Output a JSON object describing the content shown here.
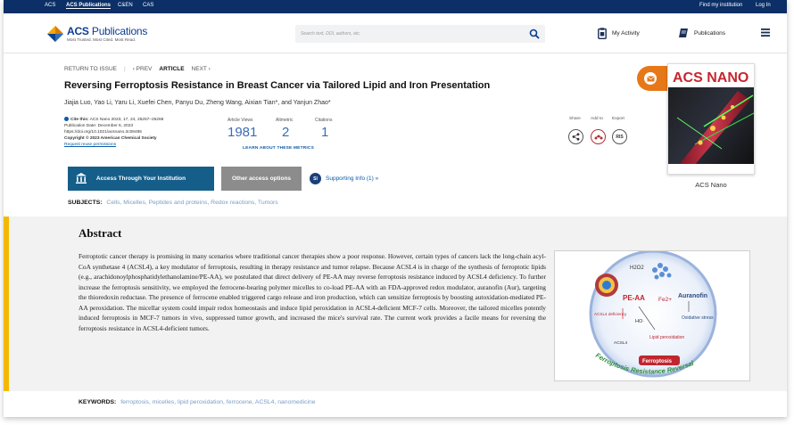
{
  "topbar": {
    "links": [
      "ACS",
      "ACS Publications",
      "C&EN",
      "CAS"
    ],
    "find_institution": "Find my institution",
    "login": "Log In"
  },
  "header": {
    "logo_title_bold": "ACS",
    "logo_title_rest": "Publications",
    "logo_tagline": "Most Trusted. Most Cited. Most Read.",
    "search_placeholder": "Search text, DOI, authors, etc.",
    "my_activity": "My Activity",
    "publications": "Publications"
  },
  "breadcrumb": {
    "return": "RETURN TO ISSUE",
    "prev": "‹ PREV",
    "current": "ARTICLE",
    "next": "NEXT ›"
  },
  "article": {
    "title": "Reversing Ferroptosis Resistance in Breast Cancer via Tailored Lipid and Iron Presentation",
    "authors": "Jiajia Luo, Yao Li, Yaru Li, Xuefei Chen, Panyu Du, Zheng Wang, Aixian Tian*, and Yanjun Zhao*",
    "cite_label": "Cite this:",
    "cite_text": "ACS Nano 2023, 17, 24, 25257–25268",
    "pub_date": "Publication Date: December 6, 2023",
    "doi": "https://doi.org/10.1021/acsnano.3c08485",
    "copyright": "Copyright © 2023 American Chemical Society",
    "reuse": "Request reuse permissions"
  },
  "metrics": {
    "views_label": "Article Views",
    "views": "1981",
    "altmetric_label": "Altmetric",
    "altmetric": "2",
    "citations_label": "Citations",
    "citations": "1",
    "learn_more": "LEARN ABOUT THESE METRICS"
  },
  "share": {
    "share_label": "Share",
    "add_label": "Add to",
    "export_label": "Export",
    "ris": "RIS"
  },
  "journal": {
    "cover_logo": "ACS NANO",
    "name": "ACS Nano"
  },
  "access": {
    "institution_button": "Access Through Your Institution",
    "other_button": "Other access options",
    "si_badge": "SI",
    "supporting": "Supporting Info (1) »"
  },
  "subjects": {
    "label": "SUBJECTS:",
    "items": "Cells, Micelles, Peptides and proteins, Redox reactions, Tumors"
  },
  "abstract": {
    "heading": "Abstract",
    "text": "Ferroptotic cancer therapy is promising in many scenarios where traditional cancer therapies show a poor response. However, certain types of cancers lack the long-chain acyl-CoA synthetase 4 (ACSL4), a key modulator of ferroptosis, resulting in therapy resistance and tumor relapse. Because ACSL4 is in charge of the synthesis of ferroptotic lipids (e.g., arachidonoylphosphatidylethanolamine/PE-AA), we postulated that direct delivery of PE-AA may reverse ferroptosis resistance induced by ACSL4 deficiency. To further increase the ferroptosis sensitivity, we employed the ferrocene-bearing polymer micelles to co-load PE-AA with an FDA-approved redox modulator, auranofin (Aur), targeting the thioredoxin reductase. The presence of ferrocene enabled triggered cargo release and iron production, which can sensitize ferroptosis by boosting autoxidation-mediated PE-AA peroxidation. The micellar system could impair redox homeostasis and induce lipid peroxidation in ACSL4-deficient MCF-7 cells. Moreover, the tailored micelles potently induced ferroptosis in MCF-7 tumors in vivo, suppressed tumor growth, and increased the mice's survival rate. The current work provides a facile means for reversing the ferroptosis resistance in ACSL4-deficient tumors."
  },
  "toc": {
    "h2o2": "H2O2",
    "fe": "Fe2+",
    "pe_aa": "PE-AA",
    "auranofin": "Auranofin",
    "acsl4_def": "ACSL4 deficiency",
    "ho": "HO·",
    "oxidative": "Oxidative stress",
    "acsl4": "ACSL4",
    "lipid": "Lipid peroxidation",
    "ferroptosis": "Ferroptosis",
    "arc": "Ferroptosis Resistance Reversal"
  },
  "keywords": {
    "label": "KEYWORDS:",
    "items": "ferroptosis, micelles, lipid peroxidation, ferrocene, ACSL4, nanomedicine"
  },
  "colors": {
    "topbar": "#0b2f66",
    "accent_blue": "#155e8a",
    "metric_blue": "#3a6db5",
    "abstract_bar": "#f5b800",
    "mail_orange": "#e67817"
  }
}
